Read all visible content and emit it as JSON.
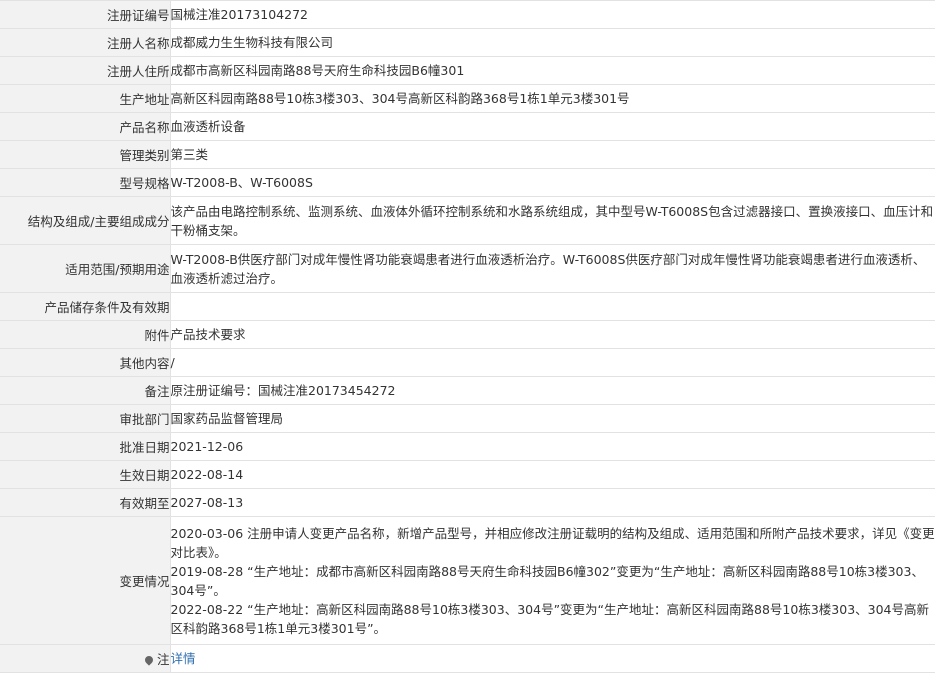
{
  "rows": [
    {
      "label": "注册证编号",
      "value": "国械注准20173104272"
    },
    {
      "label": "注册人名称",
      "value": "成都威力生生物科技有限公司"
    },
    {
      "label": "注册人住所",
      "value": "成都市高新区科园南路88号天府生命科技园B6幢301"
    },
    {
      "label": "生产地址",
      "value": "高新区科园南路88号10栋3楼303、304号高新区科韵路368号1栋1单元3楼301号"
    },
    {
      "label": "产品名称",
      "value": "血液透析设备"
    },
    {
      "label": "管理类别",
      "value": "第三类"
    },
    {
      "label": "型号规格",
      "value": "W-T2008-B、W-T6008S"
    },
    {
      "label": "结构及组成/主要组成成分",
      "value": "该产品由电路控制系统、监测系统、血液体外循环控制系统和水路系统组成，其中型号W-T6008S包含过滤器接口、置换液接口、血压计和干粉桶支架。"
    },
    {
      "label": "适用范围/预期用途",
      "value": "W-T2008-B供医疗部门对成年慢性肾功能衰竭患者进行血液透析治疗。W-T6008S供医疗部门对成年慢性肾功能衰竭患者进行血液透析、血液透析滤过治疗。"
    },
    {
      "label": "产品储存条件及有效期",
      "value": ""
    },
    {
      "label": "附件",
      "value": "产品技术要求"
    },
    {
      "label": "其他内容",
      "value": "/"
    },
    {
      "label": "备注",
      "value": "原注册证编号：国械注准20173454272"
    },
    {
      "label": "审批部门",
      "value": "国家药品监督管理局"
    },
    {
      "label": "批准日期",
      "value": "2021-12-06"
    },
    {
      "label": "生效日期",
      "value": "2022-08-14"
    },
    {
      "label": "有效期至",
      "value": "2027-08-13"
    }
  ],
  "changes": {
    "label": "变更情况",
    "items": [
      "2020-03-06 注册申请人变更产品名称，新增产品型号，并相应修改注册证载明的结构及组成、适用范围和所附产品技术要求，详见《变更对比表》。",
      "2019-08-28 “生产地址：成都市高新区科园南路88号天府生命科技园B6幢302”变更为“生产地址：高新区科园南路88号10栋3楼303、304号”。",
      "2022-08-22 “生产地址：高新区科园南路88号10栋3楼303、304号”变更为“生产地址：高新区科园南路88号10栋3楼303、304号高新区科韵路368号1栋1单元3楼301号”。"
    ]
  },
  "note": {
    "label": "注",
    "link": "详情",
    "icon": "pin-icon"
  }
}
